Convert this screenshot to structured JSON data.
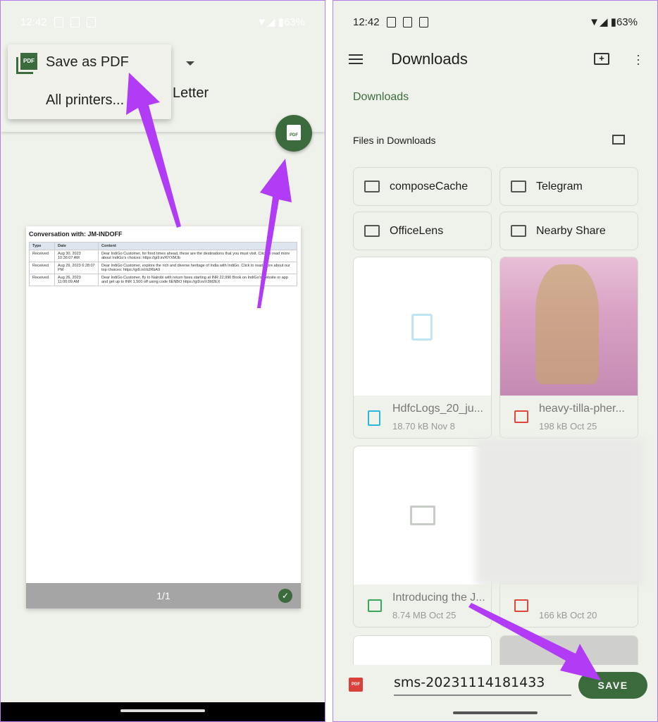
{
  "left": {
    "status": {
      "time": "12:42",
      "battery": "63%"
    },
    "printer_menu": {
      "items": [
        {
          "label": "Save as PDF"
        },
        {
          "label": "All printers..."
        }
      ]
    },
    "paper_size": "Letter",
    "preview": {
      "title": "Conversation with: JM-INDOFF",
      "columns": [
        "Type",
        "Date",
        "Content"
      ],
      "rows": [
        [
          "Received",
          "Aug 30, 2023 10:36:07 AM",
          "Dear IndiGo Customer, for food times ahead, these are the destinations that you must visit. Click to read more about IndiGo's choices: https://gi9.in//6YXMJb"
        ],
        [
          "Received",
          "Aug 29, 2023 6:28:07 PM",
          "Dear IndiGo Customer, explore the rich and diverse heritage of India with IndiGo. Click to read more about our top choices: https://gi9.in//dJRbA9"
        ],
        [
          "Received",
          "Aug 26, 2023 11:00:09 AM",
          "Dear IndiGo Customer, fly to Nairobi with return fares starting at INR 22,990 Book on IndiGo's website or app and get up to INR 1,500 off using code 6ENBO https://gi9.in//r3M2EX"
        ]
      ],
      "page_indicator": "1/1"
    },
    "fab_label": "PDF"
  },
  "right": {
    "status": {
      "time": "12:42",
      "battery": "63%"
    },
    "title": "Downloads",
    "breadcrumb": "Downloads",
    "section": "Files in Downloads",
    "folders": [
      "composeCache",
      "Telegram",
      "OfficeLens",
      "Nearby Share"
    ],
    "files": [
      {
        "name": "HdfcLogs_20_ju...",
        "meta": "18.70 kB Nov 8",
        "type": "document",
        "color": "#2bb7e0"
      },
      {
        "name": "heavy-tilla-pher...",
        "meta": "198 kB Oct 25",
        "type": "image",
        "color": "#e0453c"
      },
      {
        "name": "Introducing the J...",
        "meta": "8.74 MB Oct 25",
        "type": "video",
        "color": "#3aa85a"
      },
      {
        "name": "",
        "meta": "166 kB Oct 20",
        "type": "image",
        "color": "#e0453c"
      }
    ],
    "filename": "sms-20231114181433",
    "save_label": "SAVE",
    "pdf_badge": "PDF"
  },
  "colors": {
    "accent": "#3b6b3d",
    "arrow": "#b23cf5",
    "background": "#eff2ea"
  }
}
